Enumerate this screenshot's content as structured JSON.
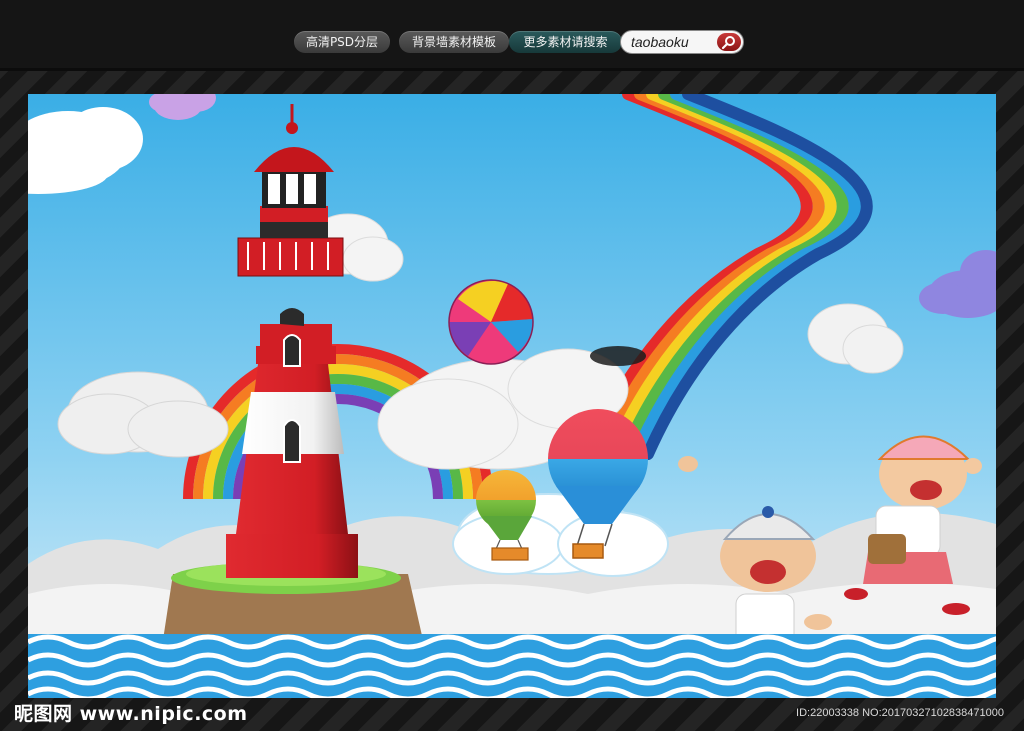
{
  "toolbar": {
    "links": [
      {
        "label": "高清PSD分层"
      },
      {
        "label": "背景墙素材模板"
      },
      {
        "label": "更多素材请搜索"
      }
    ],
    "search": {
      "value": "taobaoku",
      "icon": "search-icon"
    }
  },
  "footer": {
    "watermark": "昵图网 www.nipic.com",
    "id_text": "ID:22003338 NO:20170327102838471000"
  },
  "colors": {
    "sky": "#47b4e8",
    "sea": "#2e9fe0",
    "lighthouse_red": "#d61f26",
    "cloud": "#ececec"
  }
}
